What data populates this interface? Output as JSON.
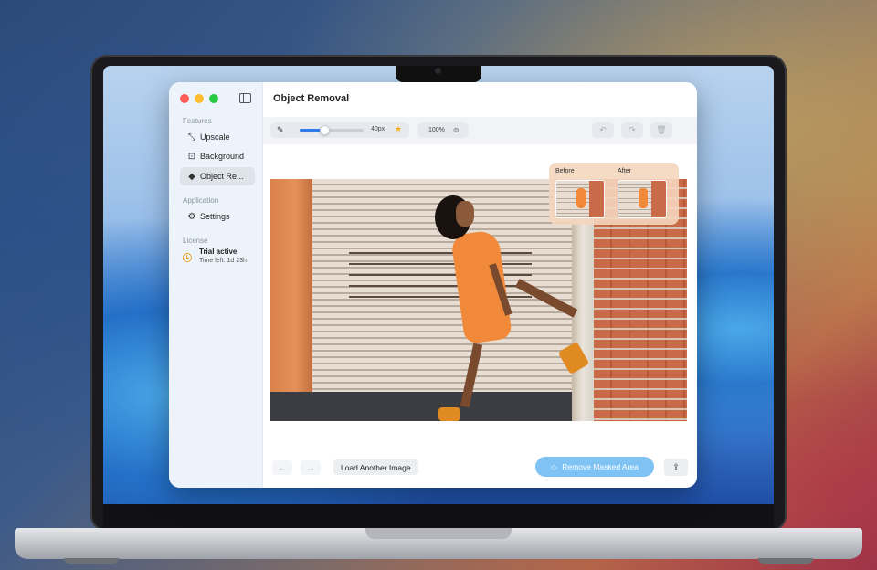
{
  "window": {
    "title": "Object Removal"
  },
  "sidebar": {
    "sections": [
      {
        "label": "Features"
      },
      {
        "label": "Application"
      },
      {
        "label": "License"
      }
    ],
    "items": [
      {
        "label": "Upscale",
        "icon": "expand-arrows-icon",
        "active": false
      },
      {
        "label": "Background",
        "icon": "background-portrait-icon",
        "active": false
      },
      {
        "label": "Object Re...",
        "icon": "eraser-icon",
        "active": true
      },
      {
        "label": "Settings",
        "icon": "gear-icon",
        "active": false
      }
    ],
    "license": {
      "title": "Trial active",
      "subtitle": "Time left: 1d 23h",
      "icon": "clock-icon"
    }
  },
  "toolbar": {
    "brush_size_label": "40px",
    "brush_level": 0.38,
    "zoom_label": "100%",
    "accent": "#2f7bea",
    "star_color": "#f2b01e"
  },
  "compare": {
    "before_label": "Before",
    "after_label": "After"
  },
  "footer": {
    "load_label": "Load Another Image",
    "remove_label": "Remove Masked Area",
    "remove_color": "#7fc2f4"
  }
}
